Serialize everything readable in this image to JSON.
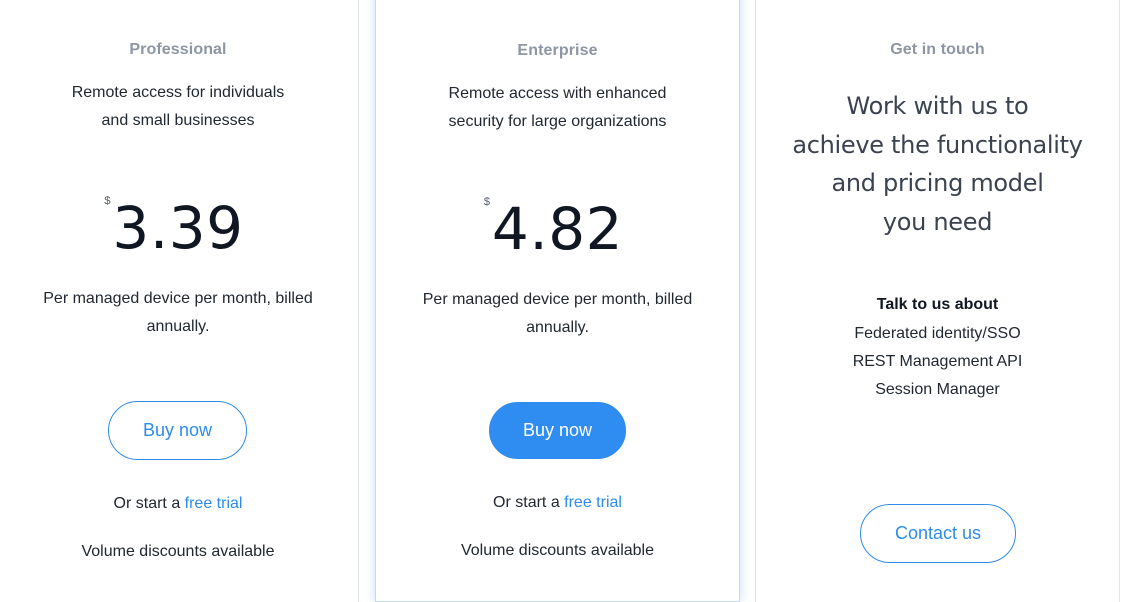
{
  "plans": {
    "professional": {
      "name": "Professional",
      "description_line1": "Remote access for individuals",
      "description_line2": "and small businesses",
      "currency": "$",
      "price": "3.39",
      "billing_line1": "Per managed device per month, billed",
      "billing_line2": "annually.",
      "cta_label": "Buy now",
      "trial_prefix": "Or start a ",
      "trial_link": "free trial",
      "volume": "Volume discounts available"
    },
    "enterprise": {
      "name": "Enterprise",
      "description_line1": "Remote access with enhanced",
      "description_line2": "security for large organizations",
      "currency": "$",
      "price": "4.82",
      "billing_line1": "Per managed device per month, billed",
      "billing_line2": "annually.",
      "cta_label": "Buy now",
      "trial_prefix": "Or start a ",
      "trial_link": "free trial",
      "volume": "Volume discounts available"
    },
    "contact": {
      "name": "Get in touch",
      "tagline_line1": "Work with us to",
      "tagline_line2": "achieve the functionality",
      "tagline_line3": "and pricing model",
      "tagline_line4": "you need",
      "talk_title": "Talk to us about",
      "topics": [
        "Federated identity/SSO",
        "REST Management API",
        "Session Manager"
      ],
      "cta_label": "Contact us"
    }
  },
  "colors": {
    "accent": "#2f8cf0",
    "plan_name": "#8e96a3",
    "text": "#222831",
    "price": "#101622"
  }
}
